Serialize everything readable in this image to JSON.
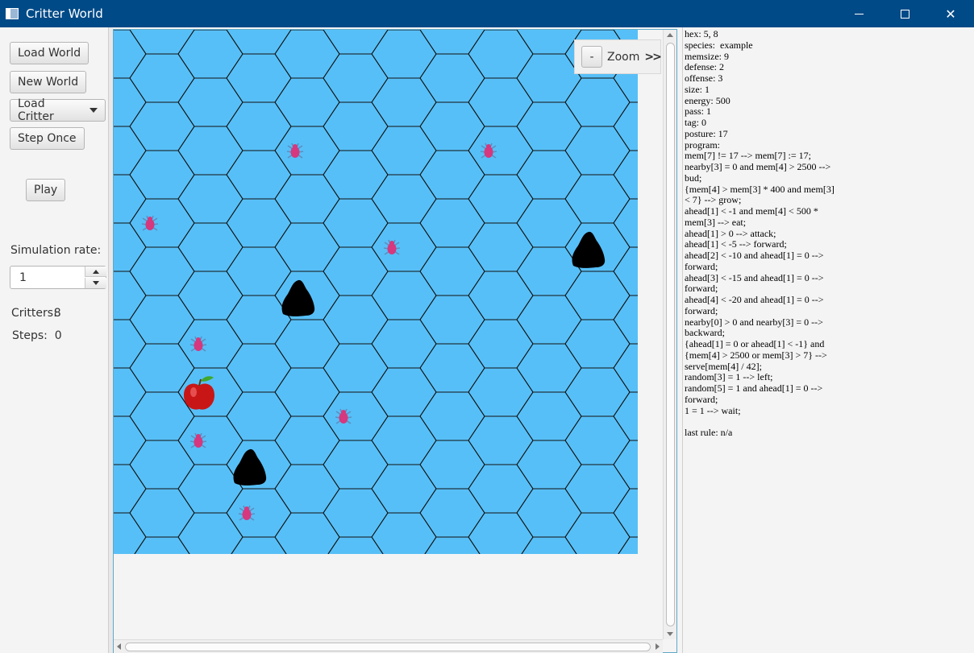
{
  "window": {
    "title": "Critter World"
  },
  "controls": {
    "load_world": "Load World",
    "new_world": "New World",
    "load_critter": "Load Critter",
    "step_once": "Step Once",
    "play": "Play",
    "simulation_rate_label": "Simulation rate:",
    "simulation_rate_value": "1",
    "critters_label": "Critters:",
    "critters_value": "8",
    "steps_label": "Steps:",
    "steps_value": "0"
  },
  "zoom": {
    "minus": "-",
    "label": "Zoom",
    "more": ">>"
  },
  "colors": {
    "water": "#57bff7",
    "hex_stroke": "#111111",
    "critter": "#d5387e",
    "rock": "#000000",
    "food": "#c81616"
  },
  "world": {
    "critters": 8,
    "rocks": 3,
    "food": 1
  },
  "critter_info": [
    "hex: 5, 8",
    "species:  example",
    "memsize: 9",
    "defense: 2",
    "offense: 3",
    "size: 1",
    "energy: 500",
    "pass: 1",
    "tag: 0",
    "posture: 17",
    "program:",
    "mem[7] != 17 --> mem[7] := 17;",
    "nearby[3] = 0 and mem[4] > 2500 -->",
    "bud;",
    "{mem[4] > mem[3] * 400 and mem[3]",
    "< 7} --> grow;",
    "ahead[1] < -1 and mem[4] < 500 *",
    "mem[3] --> eat;",
    "ahead[1] > 0 --> attack;",
    "ahead[1] < -5 --> forward;",
    "ahead[2] < -10 and ahead[1] = 0 -->",
    "forward;",
    "ahead[3] < -15 and ahead[1] = 0 -->",
    "forward;",
    "ahead[4] < -20 and ahead[1] = 0 -->",
    "forward;",
    "nearby[0] > 0 and nearby[3] = 0 -->",
    "backward;",
    "{ahead[1] = 0 or ahead[1] < -1} and",
    "{mem[4] > 2500 or mem[3] > 7} -->",
    "serve[mem[4] / 42];",
    "random[3] = 1 --> left;",
    "random[5] = 1 and ahead[1] = 0 -->",
    "forward;",
    "1 = 1 --> wait;",
    "",
    "last rule: n/a"
  ]
}
